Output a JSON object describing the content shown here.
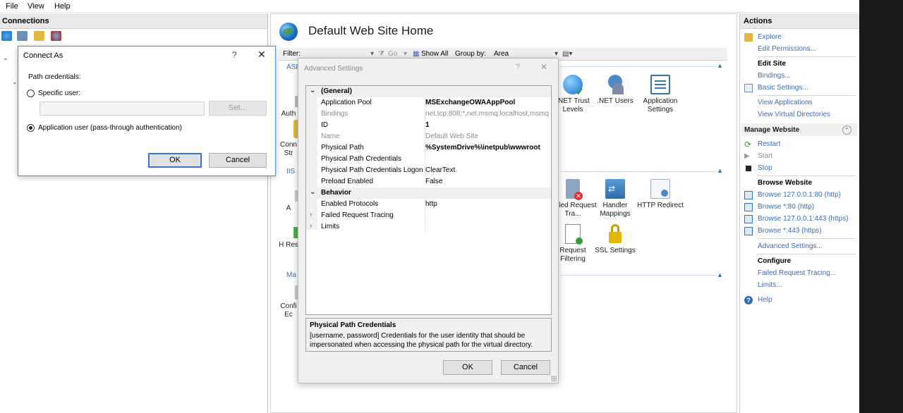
{
  "menubar": {
    "file": "File",
    "view": "View",
    "help": "Help"
  },
  "connections": {
    "title": "Connections"
  },
  "main": {
    "title": "Default Web Site Home",
    "filter": {
      "label": "Filter:",
      "go": "Go",
      "show_all": "Show All",
      "group_by_label": "Group by:",
      "group_by_value": "Area"
    },
    "groups": {
      "asp": "ASP",
      "iis": "IIS",
      "management": "Ma"
    },
    "features": {
      "net_trust": ".NET Trust Levels",
      "net_users": ".NET Users",
      "app_settings": "Application Settings",
      "failed_req": "Failed Request Tra...",
      "handler": "Handler Mappings",
      "http_redirect": "HTTP Redirect",
      "request_filtering": "Request Filtering",
      "ssl": "SSL Settings",
      "partial_auth": "Auth",
      "partial_conn": "Conn Str",
      "partial_a": "A",
      "partial_h": "H Res",
      "partial_config": "Confi Ec"
    }
  },
  "actions": {
    "title": "Actions",
    "explore": "Explore",
    "edit_permissions": "Edit Permissions...",
    "edit_site": "Edit Site",
    "bindings": "Bindings...",
    "basic_settings": "Basic Settings...",
    "view_applications": "View Applications",
    "view_virtual_dirs": "View Virtual Directories",
    "manage_website": "Manage Website",
    "restart": "Restart",
    "start": "Start",
    "stop": "Stop",
    "browse_website": "Browse Website",
    "browse1": "Browse 127.0.0.1:80 (http)",
    "browse2": "Browse *:80 (http)",
    "browse3": "Browse 127.0.0.1:443 (https)",
    "browse4": "Browse *:443 (https)",
    "advanced_settings": "Advanced Settings...",
    "configure": "Configure",
    "failed_request_tracing": "Failed Request Tracing...",
    "limits": "Limits...",
    "help": "Help"
  },
  "connect_as": {
    "title": "Connect As",
    "help": "?",
    "close": "✕",
    "path_credentials": "Path credentials:",
    "specific_user": "Specific user:",
    "set_button": "Set...",
    "app_user": "Application user (pass-through authentication)",
    "ok": "OK",
    "cancel": "Cancel"
  },
  "advanced": {
    "title": "Advanced Settings",
    "help": "?",
    "close": "✕",
    "rows": [
      {
        "name": "(General)",
        "value": ""
      },
      {
        "name": "Application Pool",
        "value": "MSExchangeOWAAppPool"
      },
      {
        "name": "Bindings",
        "value": "net.tcp:808:*,net.msmq:localhost,msmq"
      },
      {
        "name": "ID",
        "value": "1"
      },
      {
        "name": "Name",
        "value": "Default Web Site"
      },
      {
        "name": "Physical Path",
        "value": "%SystemDrive%\\inetpub\\wwwroot"
      },
      {
        "name": "Physical Path Credentials",
        "value": ""
      },
      {
        "name": "Physical Path Credentials Logon",
        "value": "ClearText"
      },
      {
        "name": "Preload Enabled",
        "value": "False"
      },
      {
        "name": "Behavior",
        "value": ""
      },
      {
        "name": "Enabled Protocols",
        "value": "http"
      },
      {
        "name": "Failed Request Tracing",
        "value": ""
      },
      {
        "name": "Limits",
        "value": ""
      }
    ],
    "description_title": "Physical Path Credentials",
    "description_text": "[username, password] Credentials for the user identity that should be impersonated when accessing the physical path for the virtual directory.",
    "ok": "OK",
    "cancel": "Cancel"
  },
  "colors": {
    "link": "#3a6eb5",
    "dialog_border": "#4a8cd8",
    "dark_strip": "#1a1a1a"
  }
}
